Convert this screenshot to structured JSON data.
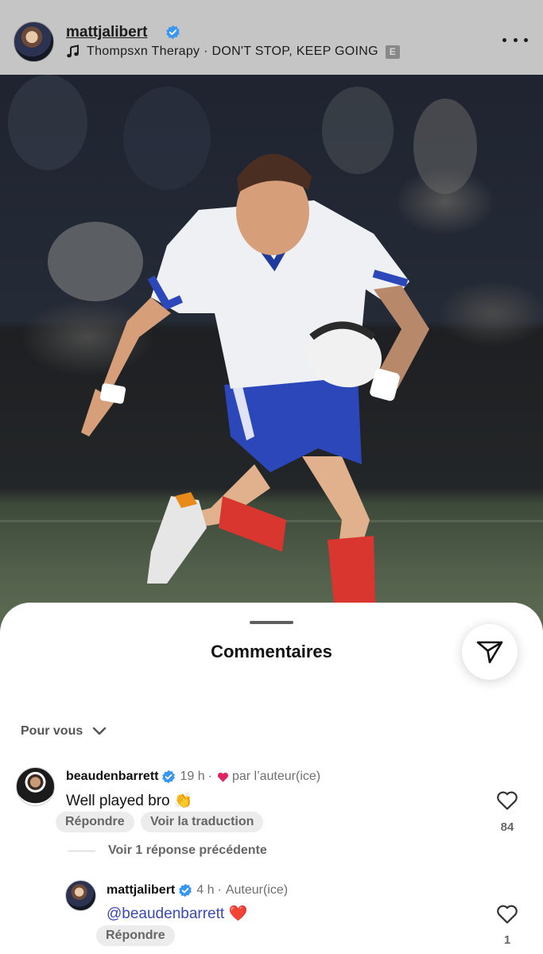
{
  "header": {
    "username": "mattjalibert",
    "music": "Thompsxn Therapy · DON'T STOP, KEEP GOING",
    "explicit_badge": "E",
    "more_icon": "more-horizontal-icon"
  },
  "sheet": {
    "title": "Commentaires",
    "share_icon": "paper-plane-icon",
    "filter_label": "Pour vous"
  },
  "comments": [
    {
      "username": "beaudenbarrett",
      "time": "19 h",
      "liked_by_author": "par l’auteur(ice)",
      "text": "Well played bro 👏",
      "reply_label": "Répondre",
      "translate_label": "Voir la traduction",
      "likes": "84"
    }
  ],
  "replies_toggle": "Voir 1 réponse précédente",
  "reply": {
    "username": "mattjalibert",
    "time": "4 h",
    "role": "Auteur(ice)",
    "mention": "@beaudenbarrett",
    "emoji": "❤️",
    "reply_label": "Répondre",
    "likes": "1"
  },
  "colors": {
    "verified": "#3897f0",
    "heart": "#e0245e",
    "mention": "#3a49b8"
  }
}
